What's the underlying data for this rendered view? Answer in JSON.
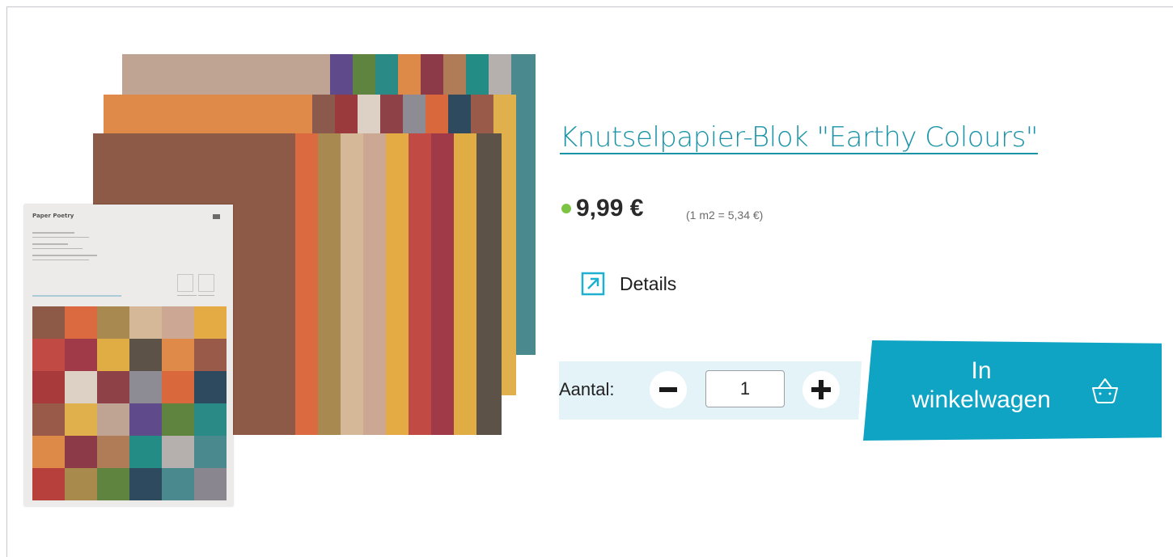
{
  "product": {
    "title": "Knutselpapier-Blok \"Earthy Colours\"",
    "price": "9,99 €",
    "unit_price": "(1 m2 = 5,34 €)",
    "availability_color": "#7dc444",
    "details_label": "Details"
  },
  "image": {
    "cover_brand": "Paper Poetry"
  },
  "quantity": {
    "label": "Aantal:",
    "value": "1"
  },
  "cart": {
    "line1": "In",
    "line2": "winkelwagen"
  },
  "colors": {
    "accent": "#0fa3c4",
    "link": "#1a93a8",
    "qty_bg": "#e3f3f8"
  },
  "icons": [
    "external-link-icon",
    "minus-icon",
    "plus-icon",
    "basket-icon"
  ]
}
